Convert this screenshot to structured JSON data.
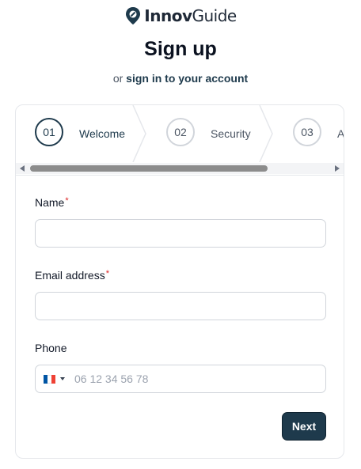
{
  "brand": {
    "name_bold": "Innov",
    "name_regular": "Guide",
    "icon": "map-pin-logo-icon",
    "color": "#1e3a4c"
  },
  "page": {
    "title": "Sign up",
    "subtitle_prefix": "or",
    "signin_link": "sign in to your account"
  },
  "steps": [
    {
      "number": "01",
      "label": "Welcome",
      "state": "active"
    },
    {
      "number": "02",
      "label": "Security",
      "state": "inactive"
    },
    {
      "number": "03",
      "label": "A",
      "state": "inactive"
    }
  ],
  "form": {
    "name_label": "Name",
    "name_required": "*",
    "name_value": "",
    "email_label": "Email address",
    "email_required": "*",
    "email_value": "",
    "phone_label": "Phone",
    "phone_placeholder": "06 12 34 56 78",
    "phone_country": "FR",
    "phone_flag_colors": [
      "#0055a4",
      "#ffffff",
      "#ef4135"
    ],
    "next_label": "Next"
  },
  "colors": {
    "accent": "#1e3a4c",
    "required": "#dc2626"
  }
}
